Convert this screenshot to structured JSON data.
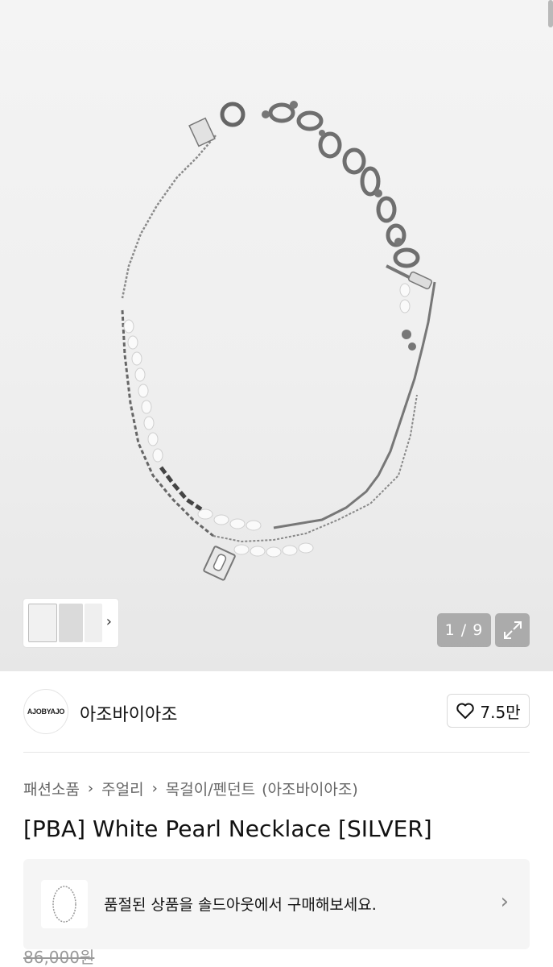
{
  "gallery": {
    "current": "1",
    "total": "9",
    "counter_text": "1 / 9"
  },
  "brand": {
    "logo_text": "AJOBYAJO",
    "name": "아조바이아조",
    "likes": "7.5만"
  },
  "breadcrumb": {
    "items": [
      "패션소품",
      "주얼리",
      "목걸이/펜던트",
      "(아조바이아조)"
    ]
  },
  "product": {
    "title": "[PBA] White Pearl Necklace [SILVER]",
    "original_price": "86,000원"
  },
  "soldout_banner": {
    "text": "품절된 상품을 솔드아웃에서 구매해보세요."
  },
  "icons": {
    "heart": "heart-icon",
    "expand": "expand-icon",
    "chevron": "chevron-right-icon"
  }
}
